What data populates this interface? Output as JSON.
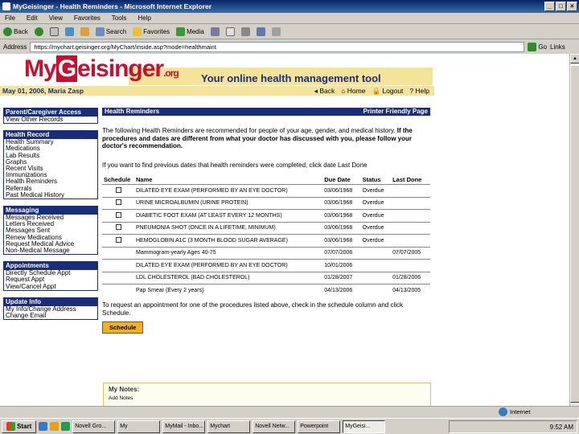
{
  "window": {
    "title": "MyGeisinger - Health Reminders - Microsoft Internet Explorer",
    "controls": [
      "_",
      "□",
      "×"
    ]
  },
  "menu": [
    "File",
    "Edit",
    "View",
    "Favorites",
    "Tools",
    "Help"
  ],
  "toolbar": {
    "back": "Back",
    "search": "Search",
    "favorites": "Favorites",
    "media": "Media"
  },
  "address": {
    "label": "Address",
    "url": "https://mychart.geisinger.org/MyChart/inside.asp?mode=healthmaint",
    "go": "Go",
    "links": "Links"
  },
  "site": {
    "logo_my": "My",
    "logo_g": "G",
    "logo_rest": "eisinger",
    "logo_tld": ".org",
    "tagline": "Your online health management tool",
    "date_user": "May 01, 2006,    Maria Zasp",
    "nav": [
      "Back",
      "Home",
      "Logout",
      "Help"
    ]
  },
  "sidebar": [
    {
      "header": "Parent/Caregiver Access",
      "items": [
        "View Other Records"
      ]
    },
    {
      "header": "Health Record",
      "items": [
        "Health Summary",
        "Medications",
        "Lab Results",
        "Graphs",
        "Recent Visits",
        "Immunizations",
        "Health Reminders",
        "Referrals",
        "Past Medical History"
      ]
    },
    {
      "header": "Messaging",
      "items": [
        "Messages Received",
        "Letters Received",
        "Messages Sent",
        "Renew Medications",
        "Request Medical Advice",
        "Non-Medical Message"
      ]
    },
    {
      "header": "Appointments",
      "items": [
        "Directly Schedule Appt",
        "Request Appt",
        "View/Cancel Appt"
      ]
    },
    {
      "header": "Update Info",
      "items": [
        "My Info/Change Address",
        "Change Email"
      ]
    }
  ],
  "main": {
    "header": "Health Reminders",
    "printer_friendly": "Printer Friendly Page",
    "intro_plain": "The following Health Reminders are recommended for people of your age, gender, and medical history. ",
    "intro_bold": "If the procedures and dates are different from what your doctor has discussed with you, please follow your doctor's recommendation.",
    "intro2": "If you want to find previous dates that health reminders were completed, click date Last Done",
    "columns": [
      "Schedule",
      "Name",
      "Due Date",
      "Status",
      "Last Done"
    ],
    "rows": [
      {
        "checkbox": true,
        "name": "DILATED EYE EXAM (PERFORMED BY AN EYE DOCTOR)",
        "due": "03/06/1968",
        "status": "Overdue",
        "last": ""
      },
      {
        "checkbox": true,
        "name": "URINE MICROALBUMIN (URINE PROTEIN)",
        "due": "03/06/1968",
        "status": "Overdue",
        "last": ""
      },
      {
        "checkbox": true,
        "name": "DIABETIC FOOT EXAM (AT LEAST EVERY 12 MONTHS)",
        "due": "03/06/1968",
        "status": "Overdue",
        "last": ""
      },
      {
        "checkbox": true,
        "name": "PNEUMONIA SHOT (ONCE IN A LIFETIME, MINIMUM)",
        "due": "03/06/1968",
        "status": "Overdue",
        "last": ""
      },
      {
        "checkbox": true,
        "name": "HEMOGLOBIN A1C (3 MONTH BLOOD SUGAR AVERAGE)",
        "due": "03/06/1968",
        "status": "Overdue",
        "last": ""
      },
      {
        "checkbox": false,
        "name": "Mammogram-yearly Ages 40-75",
        "due": "07/07/2006",
        "status": "",
        "last": "07/07/2005"
      },
      {
        "checkbox": false,
        "name": "DILATED EYE EXAM (PERFORMED BY AN EYE DOCTOR)",
        "due": "10/01/2006",
        "status": "",
        "last": ""
      },
      {
        "checkbox": false,
        "name": "LDL CHOLESTEROL (BAD CHOLESTEROL)",
        "due": "01/28/2007",
        "status": "",
        "last": "01/28/2006"
      },
      {
        "checkbox": false,
        "name": "Pap Smear (Every 2 years)",
        "due": "04/13/2006",
        "status": "",
        "last": "04/13/2005"
      }
    ],
    "instructions": "To request an appointment for one of the procedures listed above, check in the schedule column and click Schedule.",
    "schedule_button": "Schedule",
    "notes_title": "My Notes:",
    "notes_sub": "Add Notes"
  },
  "statusbar": {
    "text": "",
    "zone": "Internet"
  },
  "taskbar": {
    "start": "Start",
    "tasks": [
      "Novell Gro...",
      "My",
      "MyMail - Inbo...",
      "Mychart",
      "Novell Netw...",
      "Powerpoint",
      "MyGeisi..."
    ],
    "time": "9:52 AM"
  }
}
